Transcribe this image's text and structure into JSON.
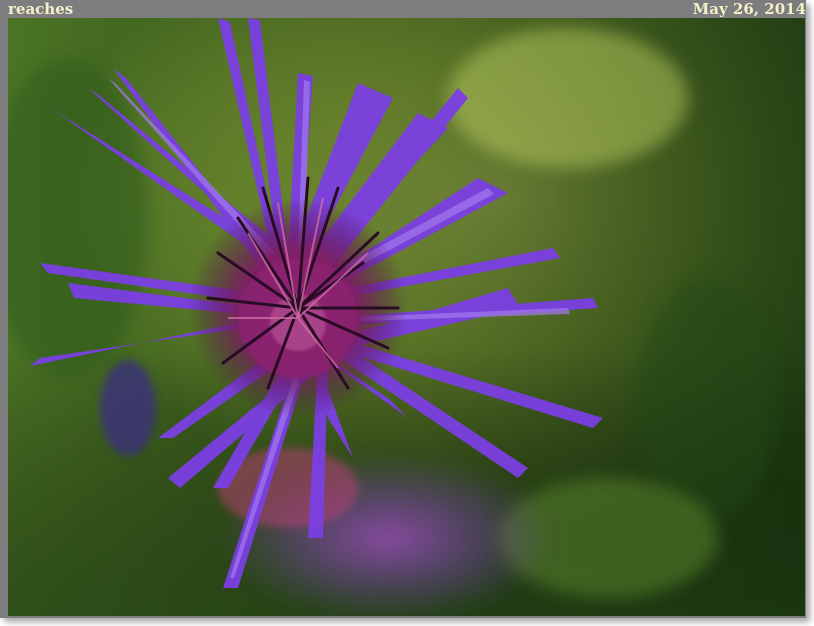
{
  "caption": {
    "title": "reaches",
    "date": "May 26, 2014"
  },
  "photo": {
    "subject_icon": "flower-photo",
    "colors": {
      "frame": "#7d7d7f",
      "caption_text": "#f4f0c8",
      "petal": "#7a3de0",
      "center": "#8a2070",
      "background_light": "#9bbf45",
      "background_dark": "#1c3d12"
    }
  }
}
